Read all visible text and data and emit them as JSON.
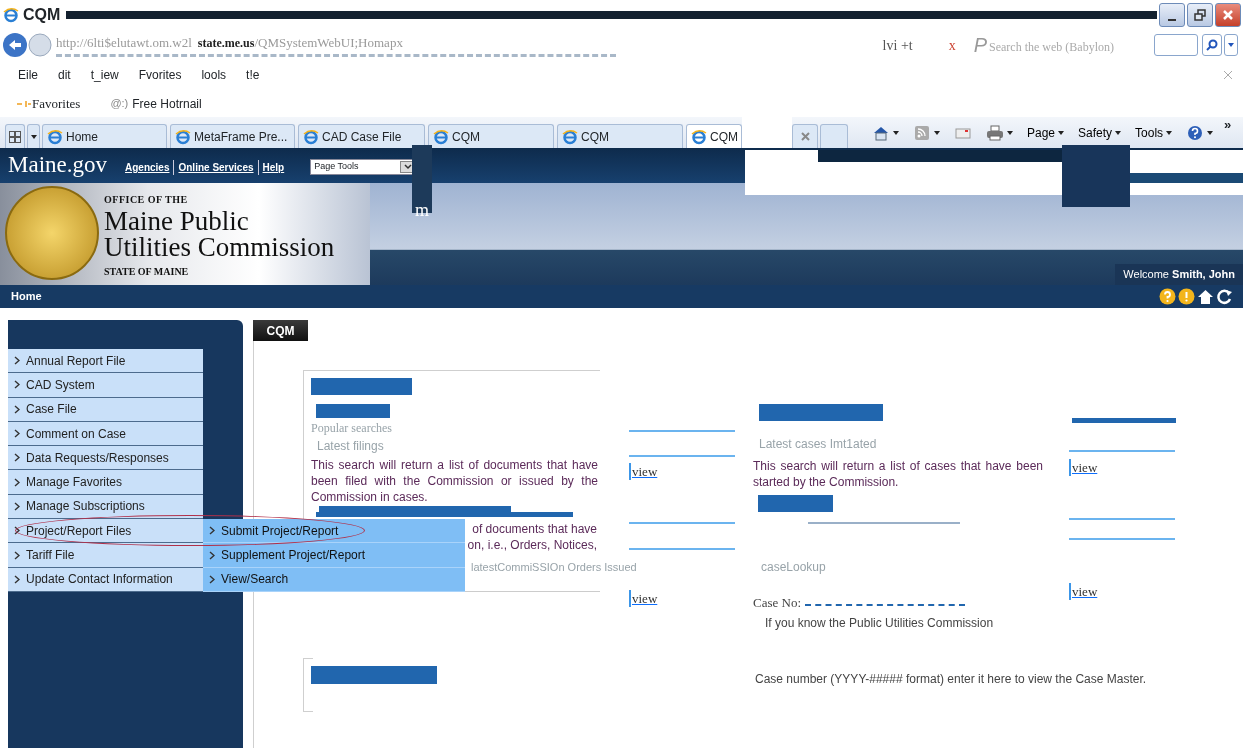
{
  "window": {
    "title": "CQM"
  },
  "address_bar": {
    "url_start": "http://6lti$elutawt.om.w2l",
    "url_host": "state.me.us",
    "url_path": "/QMSystemWebUI;Homapx"
  },
  "search_toolbar": {
    "label": "lvi +t",
    "close": "x",
    "logo": "P",
    "placeholder": "Search the web (Babylon)"
  },
  "menu": [
    "Eile",
    "dit",
    "t_iew",
    "Fvorites",
    "lools",
    "t!e"
  ],
  "favorites_bar": {
    "favorites": "Favorites",
    "links": [
      {
        "icon_text": "@:)",
        "label": "Free Hotrnail"
      }
    ]
  },
  "tabs": [
    {
      "label": "Home",
      "selected": false
    },
    {
      "label": "MetaFrame Pre...",
      "selected": false
    },
    {
      "label": "CAD Case File",
      "selected": false
    },
    {
      "label": "CQM",
      "selected": false
    },
    {
      "label": "CQM",
      "selected": false
    },
    {
      "label": "CQM",
      "selected": true
    }
  ],
  "command_bar": {
    "menus": [
      "Page",
      "Safety",
      "Tools"
    ],
    "more": "»"
  },
  "site_header": {
    "logo": "Maine.gov",
    "links": [
      "Agencies",
      "Online Services",
      "Help"
    ],
    "page_tools": "Page Tools",
    "artifact_letter": "m"
  },
  "banner": {
    "office": "OFFICE OF THE",
    "title_line1": "Maine Public",
    "title_line2": "Utilities Commission",
    "state": "STATE OF MAINE",
    "welcome": "Welcome",
    "user": "Smith, John"
  },
  "nav": {
    "home": "Home"
  },
  "sidebar": {
    "items": [
      {
        "label": "Annual Report File",
        "circled": false
      },
      {
        "label": "CAD System",
        "circled": false
      },
      {
        "label": "Case File",
        "circled": false
      },
      {
        "label": "Comment on Case",
        "circled": false
      },
      {
        "label": "Data Requests/Responses",
        "circled": false
      },
      {
        "label": "Manage Favorites",
        "circled": false
      },
      {
        "label": "Manage Subscriptions",
        "circled": false
      },
      {
        "label": "Project/Report Files",
        "circled": true,
        "children": [
          {
            "label": "Submit Project/Report"
          },
          {
            "label": "Supplement Project/Report"
          },
          {
            "label": "View/Search"
          }
        ]
      },
      {
        "label": "Tariff File",
        "circled": false
      },
      {
        "label": "Update Contact Information",
        "circled": false
      }
    ]
  },
  "main_tab": "CQM",
  "searches": {
    "popular": "Popular searches",
    "filings": {
      "title": "Latest filings",
      "text": "This search will return a list of documents that have been filed with the Commission or issued by the Commission in cases.",
      "link": "view"
    },
    "orders": {
      "fragment_1": "of documents that have",
      "fragment_2": "on, i.e., Orders, Notices,",
      "title": "latestCommiSSIOn Orders Issued",
      "link": "view"
    },
    "cases": {
      "title": "Latest cases Imt1ated",
      "text": "This search will return a list of cases that have been started by the Commission.",
      "link": "view"
    },
    "lookup": {
      "title": "caseLookup",
      "label": "Case No:",
      "hint": "If you know the Public Utilities Commission",
      "note": "Case number (YYYY-##### format) enter it here to view the Case Master.",
      "link": "view"
    }
  }
}
